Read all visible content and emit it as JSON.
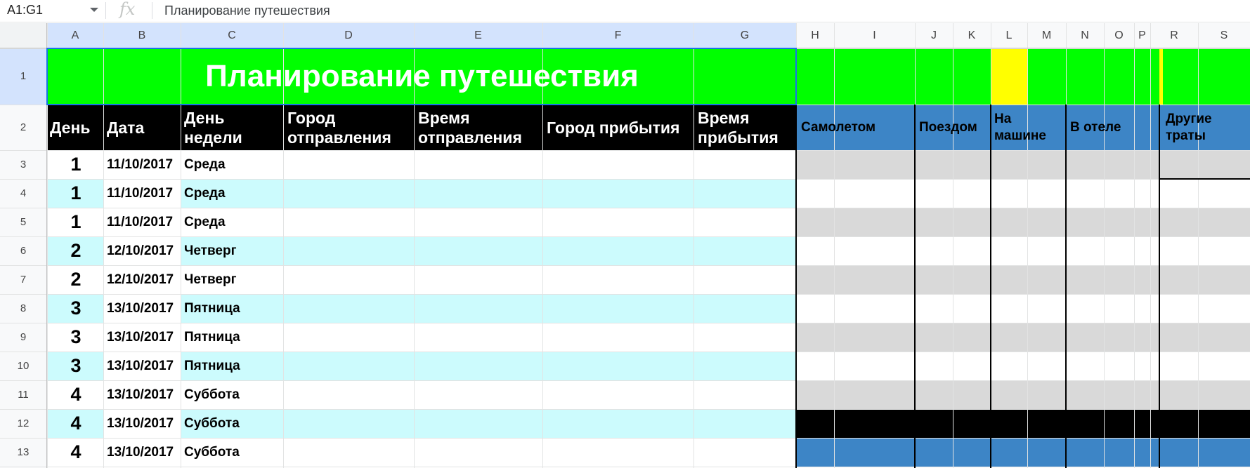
{
  "formula_bar": {
    "name_box": "A1:G1",
    "fx_label": "fx",
    "formula": "Планирование путешествия"
  },
  "columns": [
    "A",
    "B",
    "C",
    "D",
    "E",
    "F",
    "G",
    "H",
    "I",
    "J",
    "K",
    "L",
    "M",
    "N",
    "O",
    "P",
    "R",
    "S"
  ],
  "rows": [
    "1",
    "2",
    "3",
    "4",
    "5",
    "6",
    "7",
    "8",
    "9",
    "10",
    "11",
    "12",
    "13"
  ],
  "sheet": {
    "title": "Планирование путешествия",
    "headers": {
      "day": [
        "День"
      ],
      "date": [
        "Дата"
      ],
      "weekday": [
        "День",
        "недели"
      ],
      "from_city": [
        "Город",
        "отправления"
      ],
      "dep_time": [
        "Время",
        "отправления"
      ],
      "to_city": [
        "Город прибытия"
      ],
      "arr_time": [
        "Время",
        "прибытия"
      ]
    },
    "expense_headers": {
      "plane": [
        "Самолетом"
      ],
      "train": [
        "Поездом"
      ],
      "car": [
        "На",
        "машине"
      ],
      "hotel": [
        "В отеле"
      ],
      "other": [
        "Другие",
        "траты"
      ]
    },
    "data_rows": [
      {
        "day": "1",
        "date": "11/10/2017",
        "weekday": "Среда"
      },
      {
        "day": "1",
        "date": "11/10/2017",
        "weekday": "Среда"
      },
      {
        "day": "1",
        "date": "11/10/2017",
        "weekday": "Среда"
      },
      {
        "day": "2",
        "date": "12/10/2017",
        "weekday": "Четверг"
      },
      {
        "day": "2",
        "date": "12/10/2017",
        "weekday": "Четверг"
      },
      {
        "day": "3",
        "date": "13/10/2017",
        "weekday": "Пятница"
      },
      {
        "day": "3",
        "date": "13/10/2017",
        "weekday": "Пятница"
      },
      {
        "day": "3",
        "date": "13/10/2017",
        "weekday": "Пятница"
      },
      {
        "day": "4",
        "date": "13/10/2017",
        "weekday": "Суббота"
      },
      {
        "day": "4",
        "date": "13/10/2017",
        "weekday": "Суббота"
      },
      {
        "day": "4",
        "date": "13/10/2017",
        "weekday": "Суббота"
      }
    ]
  },
  "colors": {
    "title_fill": "#00ff00",
    "highlight": "#ffff00",
    "header_fill": "#000000",
    "expense_header_fill": "#3d85c6",
    "band_cyan": "#ccfbfd",
    "band_gray": "#d9d9d9"
  }
}
